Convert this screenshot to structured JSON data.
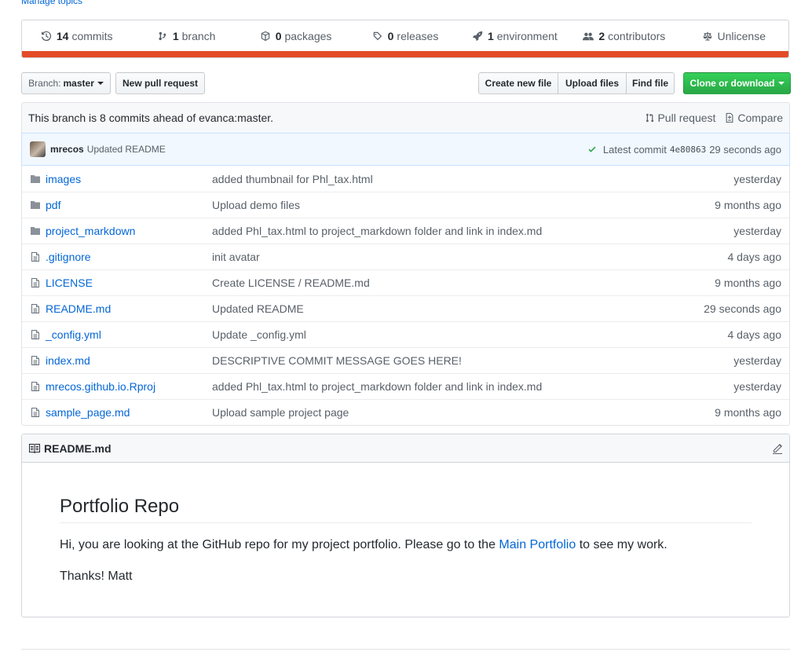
{
  "topics": {
    "manage_label": "Manage topics"
  },
  "summary": {
    "commits": {
      "count": "14",
      "label": "commits"
    },
    "branches": {
      "count": "1",
      "label": "branch"
    },
    "packages": {
      "count": "0",
      "label": "packages"
    },
    "releases": {
      "count": "0",
      "label": "releases"
    },
    "environments": {
      "count": "1",
      "label": "environment"
    },
    "contributors": {
      "count": "2",
      "label": "contributors"
    },
    "license": {
      "label": "Unlicense"
    },
    "language_color": "#e34c26"
  },
  "toolbar": {
    "branch_prefix": "Branch:",
    "branch_name": "master",
    "new_pr_label": "New pull request",
    "create_file_label": "Create new file",
    "upload_files_label": "Upload files",
    "find_file_label": "Find file",
    "clone_label": "Clone or download"
  },
  "branch_info": {
    "message": "This branch is 8 commits ahead of evanca:master.",
    "pull_request_label": "Pull request",
    "compare_label": "Compare"
  },
  "latest_commit": {
    "author": "mrecos",
    "message": "Updated README",
    "label": "Latest commit",
    "sha": "4e80863",
    "age": "29 seconds ago"
  },
  "files": [
    {
      "type": "dir",
      "name": "images",
      "message": "added thumbnail for Phl_tax.html",
      "age": "yesterday"
    },
    {
      "type": "dir",
      "name": "pdf",
      "message": "Upload demo files",
      "age": "9 months ago"
    },
    {
      "type": "dir",
      "name": "project_markdown",
      "message": "added Phl_tax.html to project_markdown folder and link in index.md",
      "age": "yesterday"
    },
    {
      "type": "file",
      "name": ".gitignore",
      "message": "init avatar",
      "age": "4 days ago"
    },
    {
      "type": "file",
      "name": "LICENSE",
      "message": "Create LICENSE / README.md",
      "age": "9 months ago"
    },
    {
      "type": "file",
      "name": "README.md",
      "message": "Updated README",
      "age": "29 seconds ago"
    },
    {
      "type": "file",
      "name": "_config.yml",
      "message": "Update _config.yml",
      "age": "4 days ago"
    },
    {
      "type": "file",
      "name": "index.md",
      "message": "DESCRIPTIVE COMMIT MESSAGE GOES HERE!",
      "age": "yesterday"
    },
    {
      "type": "file",
      "name": "mrecos.github.io.Rproj",
      "message": "added Phl_tax.html to project_markdown folder and link in index.md",
      "age": "yesterday"
    },
    {
      "type": "file",
      "name": "sample_page.md",
      "message": "Upload sample project page",
      "age": "9 months ago"
    }
  ],
  "readme": {
    "filename": "README.md",
    "heading": "Portfolio Repo",
    "intro_before_link": "Hi, you are looking at the GitHub repo for my project portfolio. Please go to the",
    "link_text": "Main Portfolio",
    "intro_after_link": "to see my work.",
    "signoff": "Thanks! Matt"
  }
}
